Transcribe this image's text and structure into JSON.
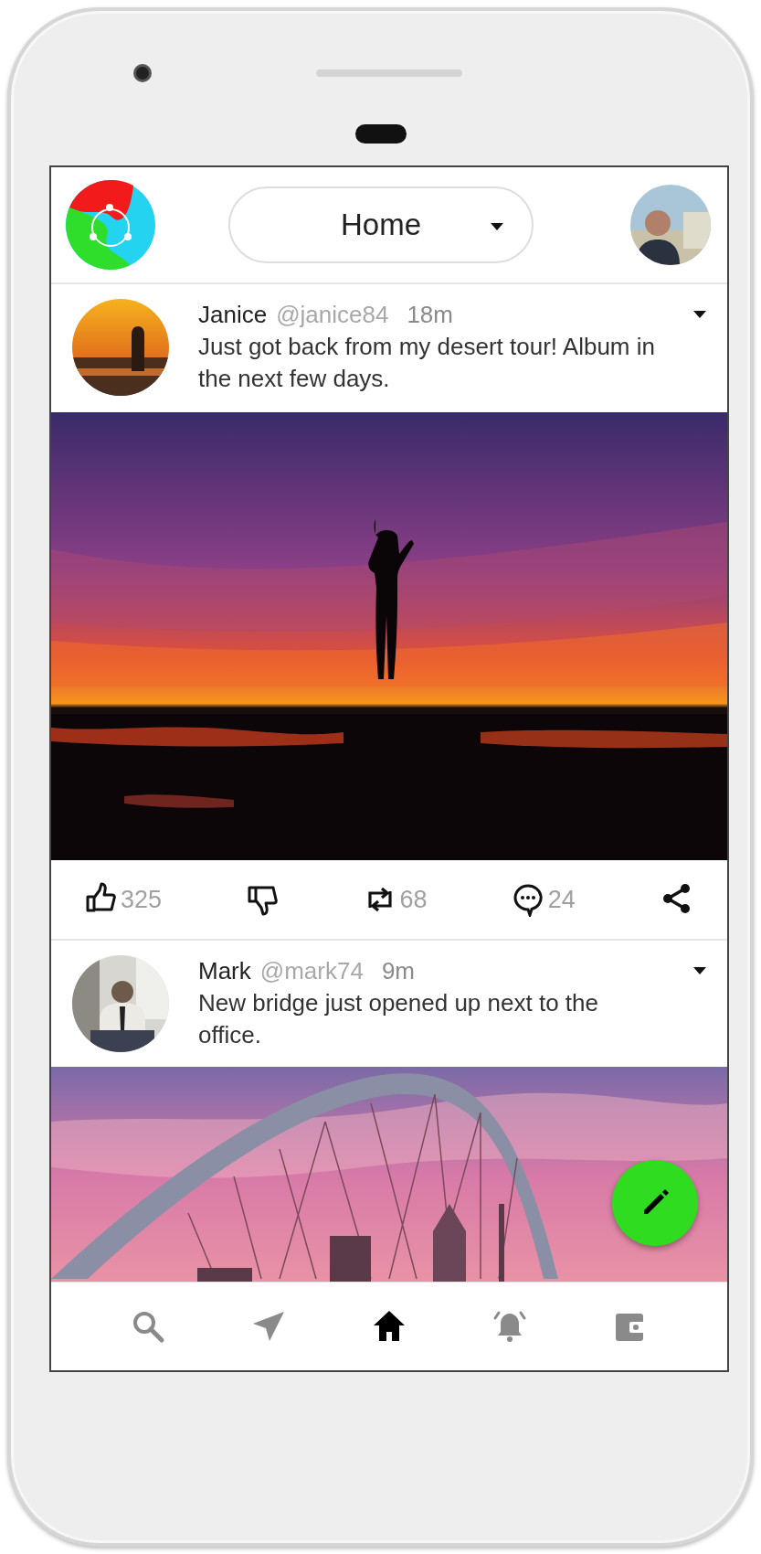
{
  "header": {
    "feed_selector": "Home"
  },
  "posts": [
    {
      "name": "Janice",
      "handle": "@janice84",
      "time": "18m",
      "text": "Just got back from my desert tour! Album in the next few days.",
      "actions": [
        {
          "kind": "like",
          "count": "325"
        },
        {
          "kind": "dislike"
        },
        {
          "kind": "repost",
          "count": "68"
        },
        {
          "kind": "comment",
          "count": "24"
        },
        {
          "kind": "share"
        }
      ]
    },
    {
      "name": "Mark",
      "handle": "@mark74",
      "time": "9m",
      "text": "New bridge just opened up next to the office."
    }
  ],
  "nav": [
    {
      "kind": "search",
      "selected": false
    },
    {
      "kind": "send",
      "selected": false
    },
    {
      "kind": "home",
      "selected": true
    },
    {
      "kind": "notifications",
      "selected": false
    },
    {
      "kind": "wallet",
      "selected": false
    }
  ]
}
